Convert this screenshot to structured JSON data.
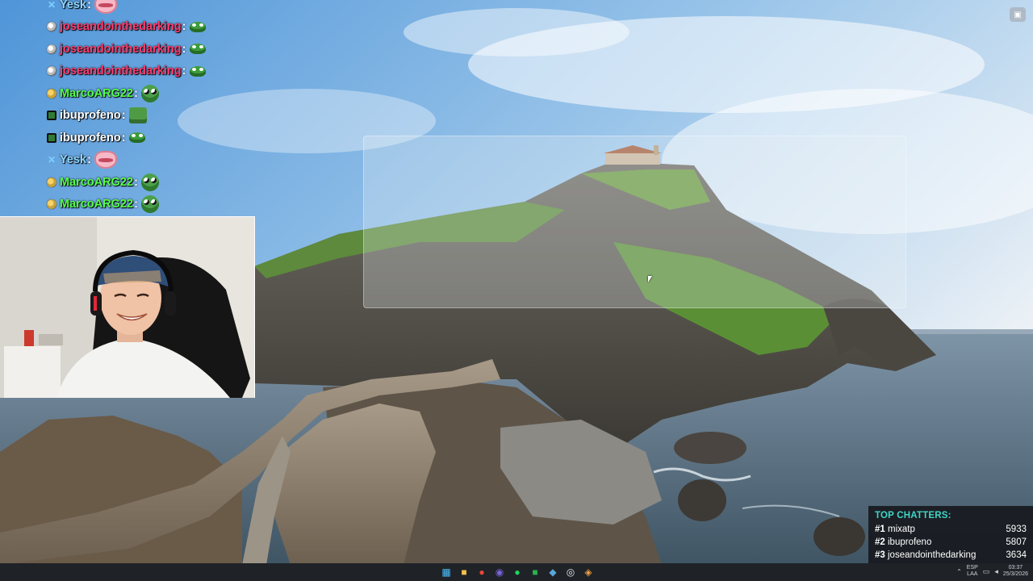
{
  "chat": {
    "messages": [
      {
        "badge": "x-badge",
        "user": "Yesk",
        "color": "#8fd6ff",
        "emote": "lips-emote"
      },
      {
        "badge": "globe-badge",
        "user": "joseandointhedarking",
        "color": "#ff3c6e",
        "emote": "frog-emote"
      },
      {
        "badge": "globe-badge",
        "user": "joseandointhedarking",
        "color": "#ff3c6e",
        "emote": "frog-emote"
      },
      {
        "badge": "globe-badge",
        "user": "joseandointhedarking",
        "color": "#ff3c6e",
        "emote": "frog-emote"
      },
      {
        "badge": "coin-badge",
        "user": "MarcoARG22",
        "color": "#57ff4a",
        "emote": "pepe-emote"
      },
      {
        "badge": "square-badge",
        "user": "ibuprofeno",
        "color": "#ffffff",
        "emote": "block-emote"
      },
      {
        "badge": "square-badge",
        "user": "ibuprofeno",
        "color": "#ffffff",
        "emote": "frog-emote"
      },
      {
        "badge": "x-badge",
        "user": "Yesk",
        "color": "#8fd6ff",
        "emote": "lips-emote"
      },
      {
        "badge": "coin-badge",
        "user": "MarcoARG22",
        "color": "#57ff4a",
        "emote": "pepe-emote"
      },
      {
        "badge": "coin-badge",
        "user": "MarcoARG22",
        "color": "#57ff4a",
        "emote": "pepe-emote"
      }
    ]
  },
  "top_chatters": {
    "title": "TOP CHATTERS:",
    "rows": [
      {
        "rank": "#1",
        "name": "mixatp",
        "count": "5933"
      },
      {
        "rank": "#2",
        "name": "ibuprofeno",
        "count": "5807"
      },
      {
        "rank": "#3",
        "name": "joseandointhedarking",
        "count": "3634"
      }
    ],
    "accent": "#3fd6c6"
  },
  "taskbar": {
    "apps": [
      {
        "icon": "windows-start-icon",
        "glyph": "▦",
        "color": "#4cc2ff"
      },
      {
        "icon": "file-explorer-icon",
        "glyph": "■",
        "color": "#f2c14e"
      },
      {
        "icon": "chrome-icon",
        "glyph": "●",
        "color": "#e9483a"
      },
      {
        "icon": "obs-icon",
        "glyph": "◉",
        "color": "#7b62d9"
      },
      {
        "icon": "spotify-icon",
        "glyph": "●",
        "color": "#1ed760"
      },
      {
        "icon": "app-green-icon",
        "glyph": "■",
        "color": "#2bb24c"
      },
      {
        "icon": "steam-icon",
        "glyph": "◆",
        "color": "#5aa6d8"
      },
      {
        "icon": "streamer-app-icon",
        "glyph": "◎",
        "color": "#e8e8e8"
      },
      {
        "icon": "extra-app-icon",
        "glyph": "◈",
        "color": "#f0a040"
      }
    ],
    "tray": {
      "lang_top": "ESP",
      "lang_bottom": "LAA",
      "time": "03:37",
      "date": "25/3/2026"
    }
  }
}
